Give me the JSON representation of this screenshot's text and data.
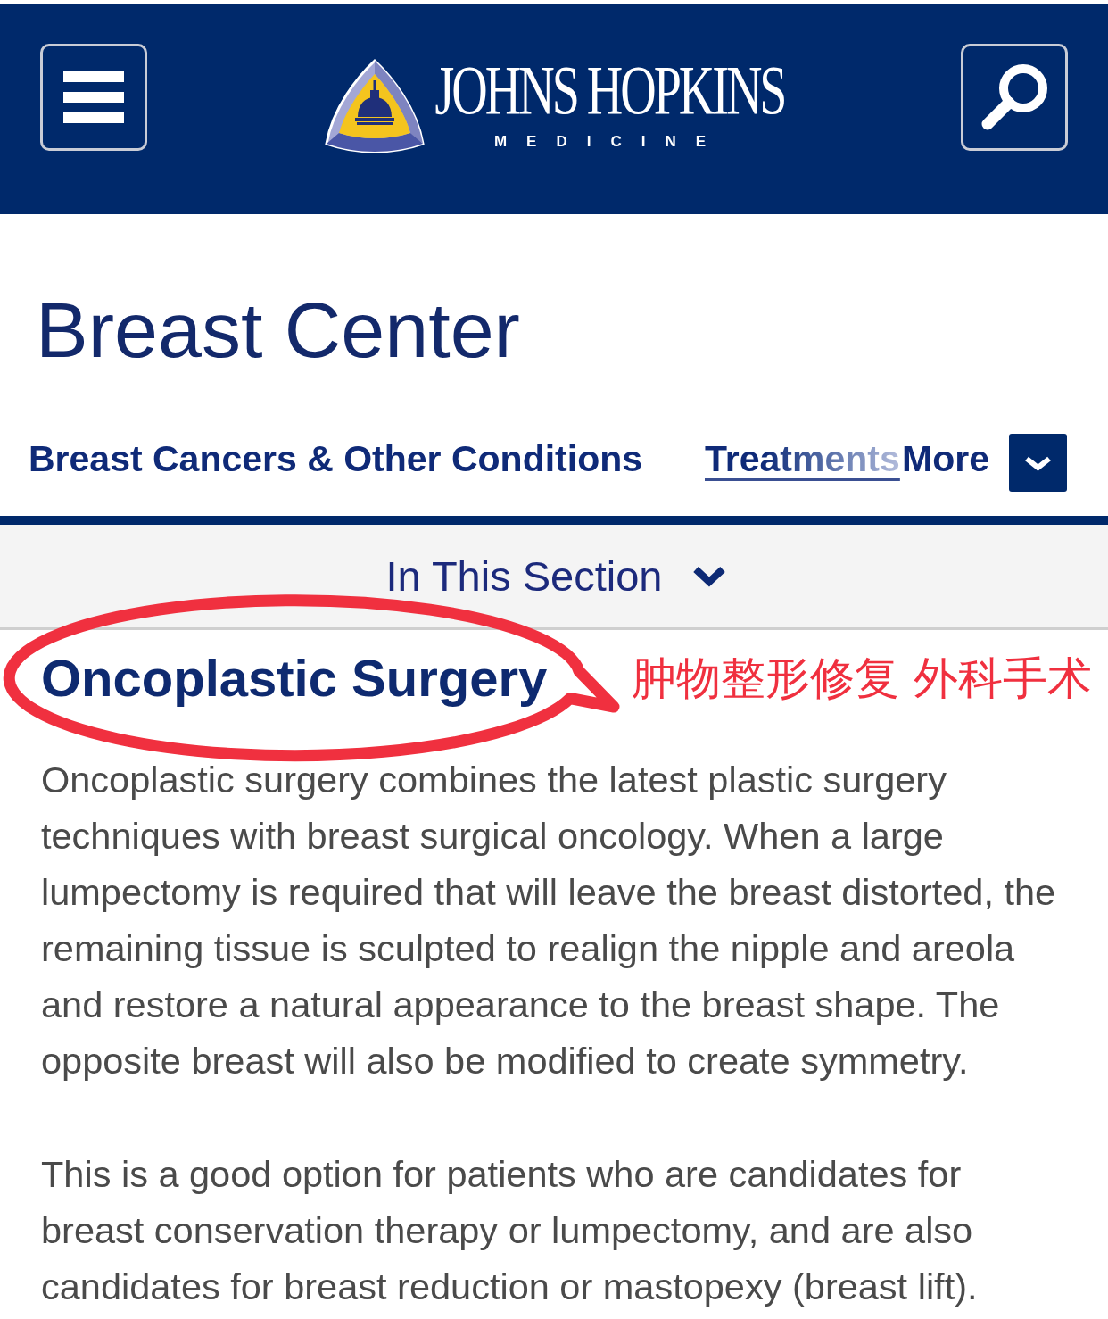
{
  "header": {
    "logo": {
      "wordmark": "JOHNS HOPKINS",
      "subtitle": "MEDICINE"
    }
  },
  "page_title": "Breast Center",
  "nav": {
    "tabs": [
      {
        "label": "Breast Cancers & Other Conditions",
        "selected": false
      },
      {
        "label": "Treatments",
        "selected": true
      }
    ],
    "more": {
      "label": "More"
    }
  },
  "section_menu": {
    "label": "In This Section",
    "expanded": false
  },
  "article": {
    "title": "Oncoplastic Surgery",
    "paragraphs": [
      "Oncoplastic surgery combines the latest plastic surgery techniques with breast surgical oncology. When a large lumpectomy is required that will leave the breast distorted, the remaining tissue is sculpted to realign the nipple and areola and restore a natural appearance to the breast shape. The opposite breast will also be modified to create symmetry.",
      "This is a good option for patients who are candidates for breast conservation therapy or lumpectomy, and are also candidates for breast reduction or mastopexy (breast lift)."
    ]
  },
  "annotation": {
    "text": "肿物整形修复 外科手术"
  }
}
